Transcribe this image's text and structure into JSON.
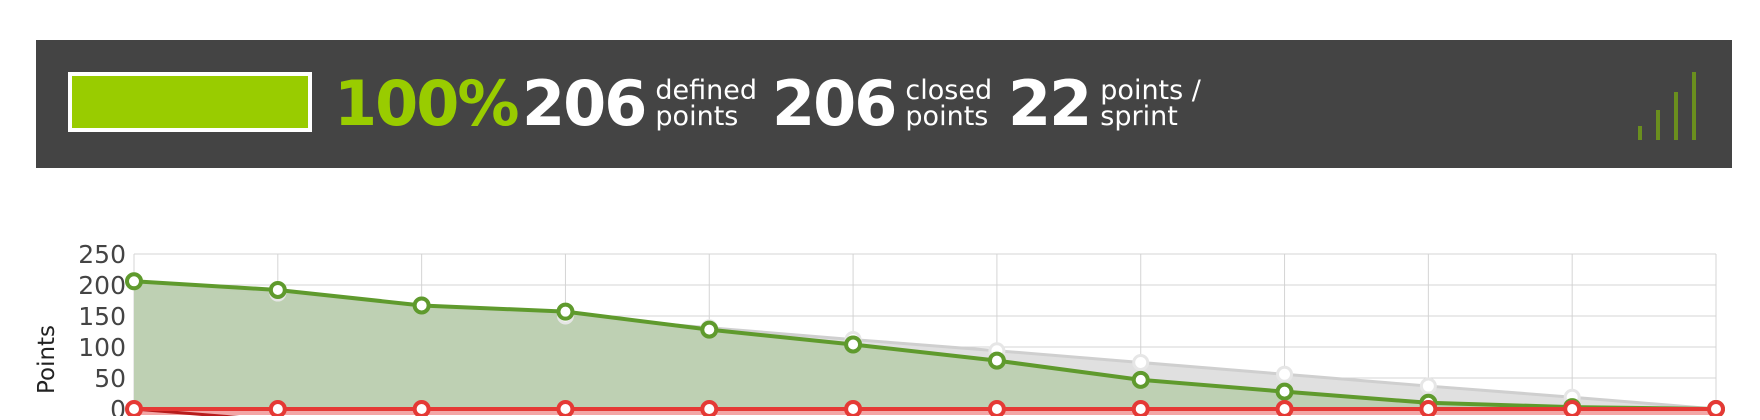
{
  "stats": {
    "progress": 1.0,
    "percent_label": "100%",
    "defined": {
      "value": "206",
      "label_line1": "defined",
      "label_line2": "points"
    },
    "closed": {
      "value": "206",
      "label_line1": "closed",
      "label_line2": "points"
    },
    "velocity": {
      "value": "22",
      "label_line1": "points /",
      "label_line2": "sprint"
    },
    "sprint_icon": "signal-bars-icon"
  },
  "colors": {
    "header_bg": "#444444",
    "progress_green": "#99cc00",
    "remaining_line": "#5f9a2d",
    "remaining_fill": "#bccfb0",
    "ideal_fill": "#e0e0e0",
    "ideal_marker": "#ffffff",
    "scope_red": "#e53935"
  },
  "chart_data": {
    "type": "line",
    "ylabel": "Points",
    "ylim": [
      0,
      250
    ],
    "yticks": [
      "250",
      "200",
      "150",
      "100",
      "50",
      "0"
    ],
    "x": [
      0,
      1,
      2,
      3,
      4,
      5,
      6,
      7,
      8,
      9,
      10,
      11
    ],
    "series": [
      {
        "key": "remaining",
        "values": [
          206,
          192,
          167,
          157,
          128,
          104,
          78,
          47,
          28,
          10,
          3,
          0
        ]
      },
      {
        "key": "ideal",
        "values": [
          206,
          187,
          168,
          150,
          131,
          112,
          94,
          75,
          56,
          37,
          19,
          0
        ]
      },
      {
        "key": "scope",
        "values": [
          0,
          0,
          0,
          0,
          0,
          0,
          0,
          0,
          0,
          0,
          0,
          0
        ]
      }
    ],
    "grid": true
  }
}
